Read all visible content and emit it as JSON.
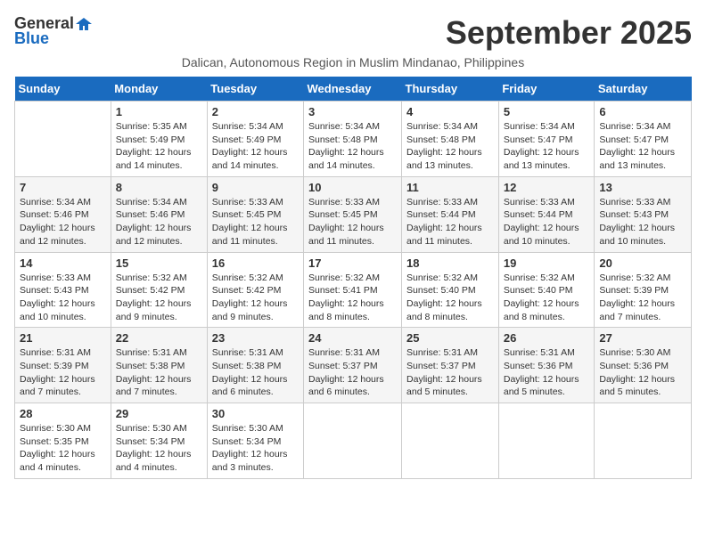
{
  "logo": {
    "general": "General",
    "blue": "Blue"
  },
  "title": "September 2025",
  "subtitle": "Dalican, Autonomous Region in Muslim Mindanao, Philippines",
  "days_of_week": [
    "Sunday",
    "Monday",
    "Tuesday",
    "Wednesday",
    "Thursday",
    "Friday",
    "Saturday"
  ],
  "weeks": [
    [
      {
        "day": "",
        "info": ""
      },
      {
        "day": "1",
        "info": "Sunrise: 5:35 AM\nSunset: 5:49 PM\nDaylight: 12 hours\nand 14 minutes."
      },
      {
        "day": "2",
        "info": "Sunrise: 5:34 AM\nSunset: 5:49 PM\nDaylight: 12 hours\nand 14 minutes."
      },
      {
        "day": "3",
        "info": "Sunrise: 5:34 AM\nSunset: 5:48 PM\nDaylight: 12 hours\nand 14 minutes."
      },
      {
        "day": "4",
        "info": "Sunrise: 5:34 AM\nSunset: 5:48 PM\nDaylight: 12 hours\nand 13 minutes."
      },
      {
        "day": "5",
        "info": "Sunrise: 5:34 AM\nSunset: 5:47 PM\nDaylight: 12 hours\nand 13 minutes."
      },
      {
        "day": "6",
        "info": "Sunrise: 5:34 AM\nSunset: 5:47 PM\nDaylight: 12 hours\nand 13 minutes."
      }
    ],
    [
      {
        "day": "7",
        "info": "Sunrise: 5:34 AM\nSunset: 5:46 PM\nDaylight: 12 hours\nand 12 minutes."
      },
      {
        "day": "8",
        "info": "Sunrise: 5:34 AM\nSunset: 5:46 PM\nDaylight: 12 hours\nand 12 minutes."
      },
      {
        "day": "9",
        "info": "Sunrise: 5:33 AM\nSunset: 5:45 PM\nDaylight: 12 hours\nand 11 minutes."
      },
      {
        "day": "10",
        "info": "Sunrise: 5:33 AM\nSunset: 5:45 PM\nDaylight: 12 hours\nand 11 minutes."
      },
      {
        "day": "11",
        "info": "Sunrise: 5:33 AM\nSunset: 5:44 PM\nDaylight: 12 hours\nand 11 minutes."
      },
      {
        "day": "12",
        "info": "Sunrise: 5:33 AM\nSunset: 5:44 PM\nDaylight: 12 hours\nand 10 minutes."
      },
      {
        "day": "13",
        "info": "Sunrise: 5:33 AM\nSunset: 5:43 PM\nDaylight: 12 hours\nand 10 minutes."
      }
    ],
    [
      {
        "day": "14",
        "info": "Sunrise: 5:33 AM\nSunset: 5:43 PM\nDaylight: 12 hours\nand 10 minutes."
      },
      {
        "day": "15",
        "info": "Sunrise: 5:32 AM\nSunset: 5:42 PM\nDaylight: 12 hours\nand 9 minutes."
      },
      {
        "day": "16",
        "info": "Sunrise: 5:32 AM\nSunset: 5:42 PM\nDaylight: 12 hours\nand 9 minutes."
      },
      {
        "day": "17",
        "info": "Sunrise: 5:32 AM\nSunset: 5:41 PM\nDaylight: 12 hours\nand 8 minutes."
      },
      {
        "day": "18",
        "info": "Sunrise: 5:32 AM\nSunset: 5:40 PM\nDaylight: 12 hours\nand 8 minutes."
      },
      {
        "day": "19",
        "info": "Sunrise: 5:32 AM\nSunset: 5:40 PM\nDaylight: 12 hours\nand 8 minutes."
      },
      {
        "day": "20",
        "info": "Sunrise: 5:32 AM\nSunset: 5:39 PM\nDaylight: 12 hours\nand 7 minutes."
      }
    ],
    [
      {
        "day": "21",
        "info": "Sunrise: 5:31 AM\nSunset: 5:39 PM\nDaylight: 12 hours\nand 7 minutes."
      },
      {
        "day": "22",
        "info": "Sunrise: 5:31 AM\nSunset: 5:38 PM\nDaylight: 12 hours\nand 7 minutes."
      },
      {
        "day": "23",
        "info": "Sunrise: 5:31 AM\nSunset: 5:38 PM\nDaylight: 12 hours\nand 6 minutes."
      },
      {
        "day": "24",
        "info": "Sunrise: 5:31 AM\nSunset: 5:37 PM\nDaylight: 12 hours\nand 6 minutes."
      },
      {
        "day": "25",
        "info": "Sunrise: 5:31 AM\nSunset: 5:37 PM\nDaylight: 12 hours\nand 5 minutes."
      },
      {
        "day": "26",
        "info": "Sunrise: 5:31 AM\nSunset: 5:36 PM\nDaylight: 12 hours\nand 5 minutes."
      },
      {
        "day": "27",
        "info": "Sunrise: 5:30 AM\nSunset: 5:36 PM\nDaylight: 12 hours\nand 5 minutes."
      }
    ],
    [
      {
        "day": "28",
        "info": "Sunrise: 5:30 AM\nSunset: 5:35 PM\nDaylight: 12 hours\nand 4 minutes."
      },
      {
        "day": "29",
        "info": "Sunrise: 5:30 AM\nSunset: 5:34 PM\nDaylight: 12 hours\nand 4 minutes."
      },
      {
        "day": "30",
        "info": "Sunrise: 5:30 AM\nSunset: 5:34 PM\nDaylight: 12 hours\nand 3 minutes."
      },
      {
        "day": "",
        "info": ""
      },
      {
        "day": "",
        "info": ""
      },
      {
        "day": "",
        "info": ""
      },
      {
        "day": "",
        "info": ""
      }
    ]
  ]
}
